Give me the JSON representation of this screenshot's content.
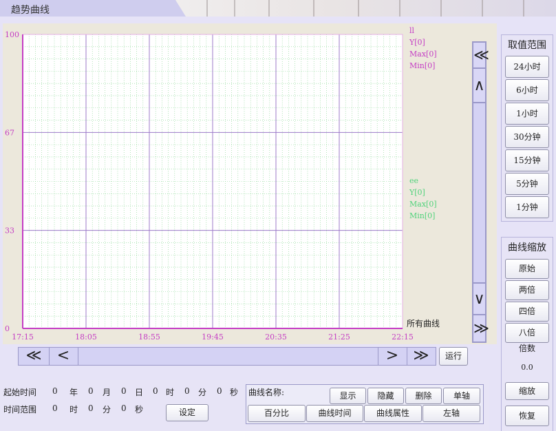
{
  "window": {
    "title": "趋势曲线"
  },
  "chart_data": {
    "type": "line",
    "y_ticks": [
      "100",
      "67",
      "33",
      "0"
    ],
    "x_ticks": [
      "17:15",
      "18:05",
      "18:55",
      "19:45",
      "20:35",
      "21:25",
      "22:15"
    ],
    "ylim": [
      0,
      100
    ],
    "grid": true,
    "series": [
      {
        "name": "ll",
        "color": "#c43cc4",
        "labels": [
          "ll",
          "Y[0]",
          "Max[0]",
          "Min[0]"
        ],
        "values": []
      },
      {
        "name": "ee",
        "color": "#4fd27a",
        "labels": [
          "ee",
          "Y[0]",
          "Max[0]",
          "Min[0]"
        ],
        "values": []
      }
    ],
    "all_curves_label": "所有曲线"
  },
  "colors": {
    "axis": "#c43cc4",
    "grid_major": "#9c79c9",
    "grid_minor": "#7fd38a",
    "panel": "#e7e4f6"
  },
  "vscroll": {
    "top_top": "≪",
    "top": "∧",
    "bottom": "∨",
    "bottom_bottom": "≫"
  },
  "hscroll": {
    "first": "≪",
    "prev": "<",
    "next": ">",
    "last": "≫"
  },
  "run_button": "运行",
  "range_panel": {
    "title": "取值范围",
    "buttons": [
      "24小时",
      "6小时",
      "1小时",
      "30分钟",
      "15分钟",
      "5分钟",
      "1分钟"
    ]
  },
  "zoom_panel": {
    "title": "曲线缩放",
    "buttons": [
      "原始",
      "两倍",
      "四倍",
      "八倍"
    ],
    "factor_label": "倍数",
    "factor_value": "0.0",
    "zoom_button": "缩放",
    "restore_button": "恢复"
  },
  "time_settings": {
    "start_label": "起始时间",
    "start_values": [
      "0",
      "0",
      "0",
      "0",
      "0",
      "0"
    ],
    "start_units": [
      "年",
      "月",
      "日",
      "时",
      "分",
      "秒"
    ],
    "range_label": "时间范围",
    "range_values": [
      "0",
      "0",
      "0"
    ],
    "range_units": [
      "时",
      "分",
      "秒"
    ],
    "set_button": "设定"
  },
  "curve_panel": {
    "name_label": "曲线名称:",
    "row1": [
      "显示",
      "隐藏",
      "删除",
      "单轴"
    ],
    "row2": [
      "百分比",
      "曲线时间",
      "曲线属性",
      "左轴"
    ]
  }
}
